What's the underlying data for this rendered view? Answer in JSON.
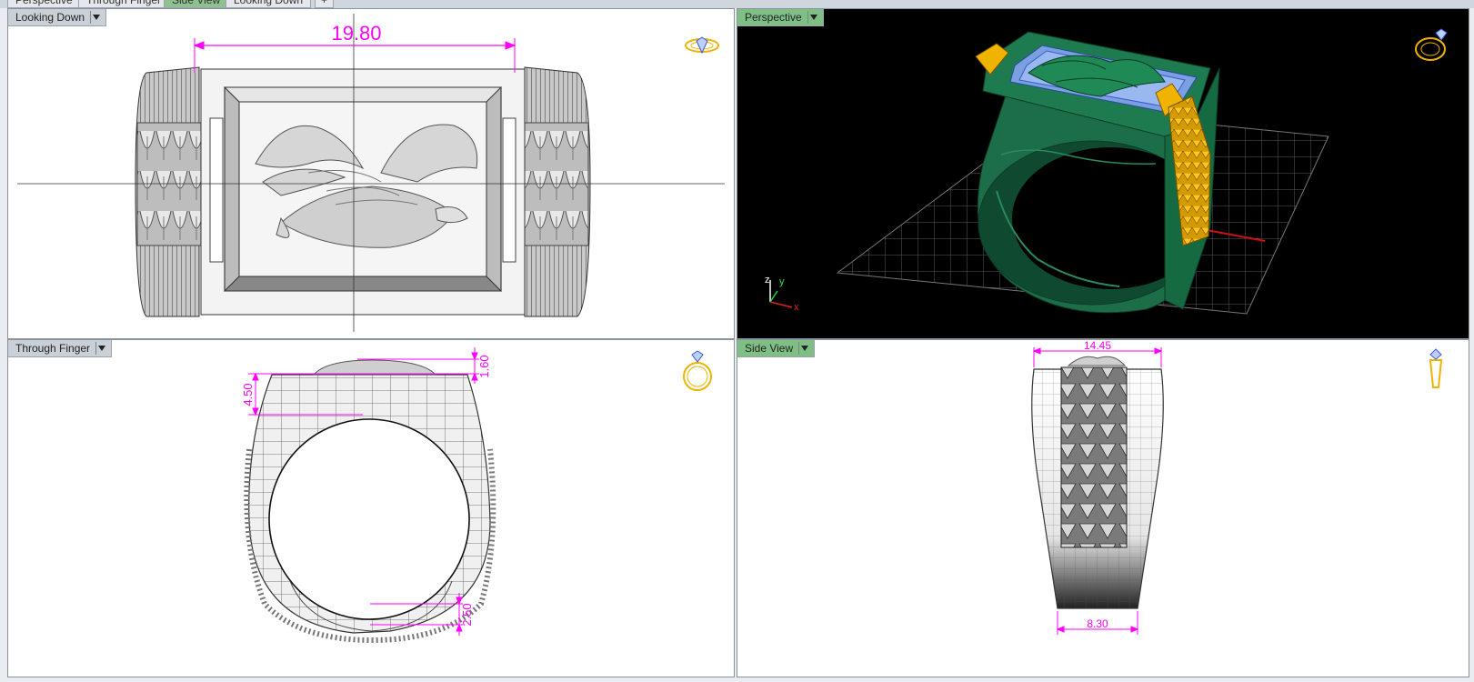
{
  "tabs": [
    {
      "label": "Perspective",
      "active": false
    },
    {
      "label": "Through Finger",
      "active": false
    },
    {
      "label": "Side View",
      "active": true
    },
    {
      "label": "Looking Down",
      "active": false
    },
    {
      "label": "+",
      "active": false
    }
  ],
  "viewports": {
    "looking_down": {
      "label": "Looking Down",
      "dimension": "19.80"
    },
    "perspective": {
      "label": "Perspective",
      "axis_z": "z",
      "axis_y": "y",
      "axis_x": "x"
    },
    "through_finger": {
      "label": "Through Finger",
      "dim_top": "1.60",
      "dim_left": "4.50",
      "dim_bottom": "2.50"
    },
    "side_view": {
      "label": "Side View",
      "dim_top": "14.45",
      "dim_bottom": "8.30"
    }
  },
  "colors": {
    "dimension": "#ff00ff",
    "perspective_bg": "#000000",
    "ring_metal": "#1e7a4f",
    "accent_gold": "#f0b400",
    "stone_blue": "#7aa0e0",
    "active_label": "#7fbf86"
  },
  "icons": [
    "ring-diamond-icon",
    "dropdown-arrow-icon",
    "axis-gizmo-icon"
  ]
}
